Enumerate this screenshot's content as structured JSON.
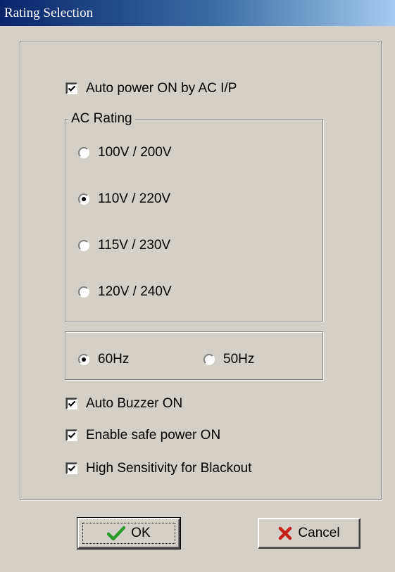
{
  "window": {
    "title": "Rating Selection"
  },
  "options": {
    "auto_power": {
      "label": "Auto power ON by AC I/P",
      "checked": true
    },
    "ac_rating": {
      "legend": "AC Rating",
      "choices": [
        {
          "label": "100V / 200V",
          "selected": false
        },
        {
          "label": "110V / 220V",
          "selected": true
        },
        {
          "label": "115V / 230V",
          "selected": false
        },
        {
          "label": "120V / 240V",
          "selected": false
        }
      ]
    },
    "frequency": {
      "choices": [
        {
          "label": "60Hz",
          "selected": true
        },
        {
          "label": "50Hz",
          "selected": false
        }
      ]
    },
    "auto_buzzer": {
      "label": "Auto Buzzer ON",
      "checked": true
    },
    "safe_power": {
      "label": "Enable safe power ON",
      "checked": true
    },
    "sensitivity": {
      "label": " High Sensitivity for Blackout",
      "checked": true
    }
  },
  "buttons": {
    "ok": {
      "label": "OK",
      "icon": "checkmark-icon",
      "color": "#2e9a2e"
    },
    "cancel": {
      "label": "Cancel",
      "icon": "x-icon",
      "color": "#c8201a"
    }
  }
}
